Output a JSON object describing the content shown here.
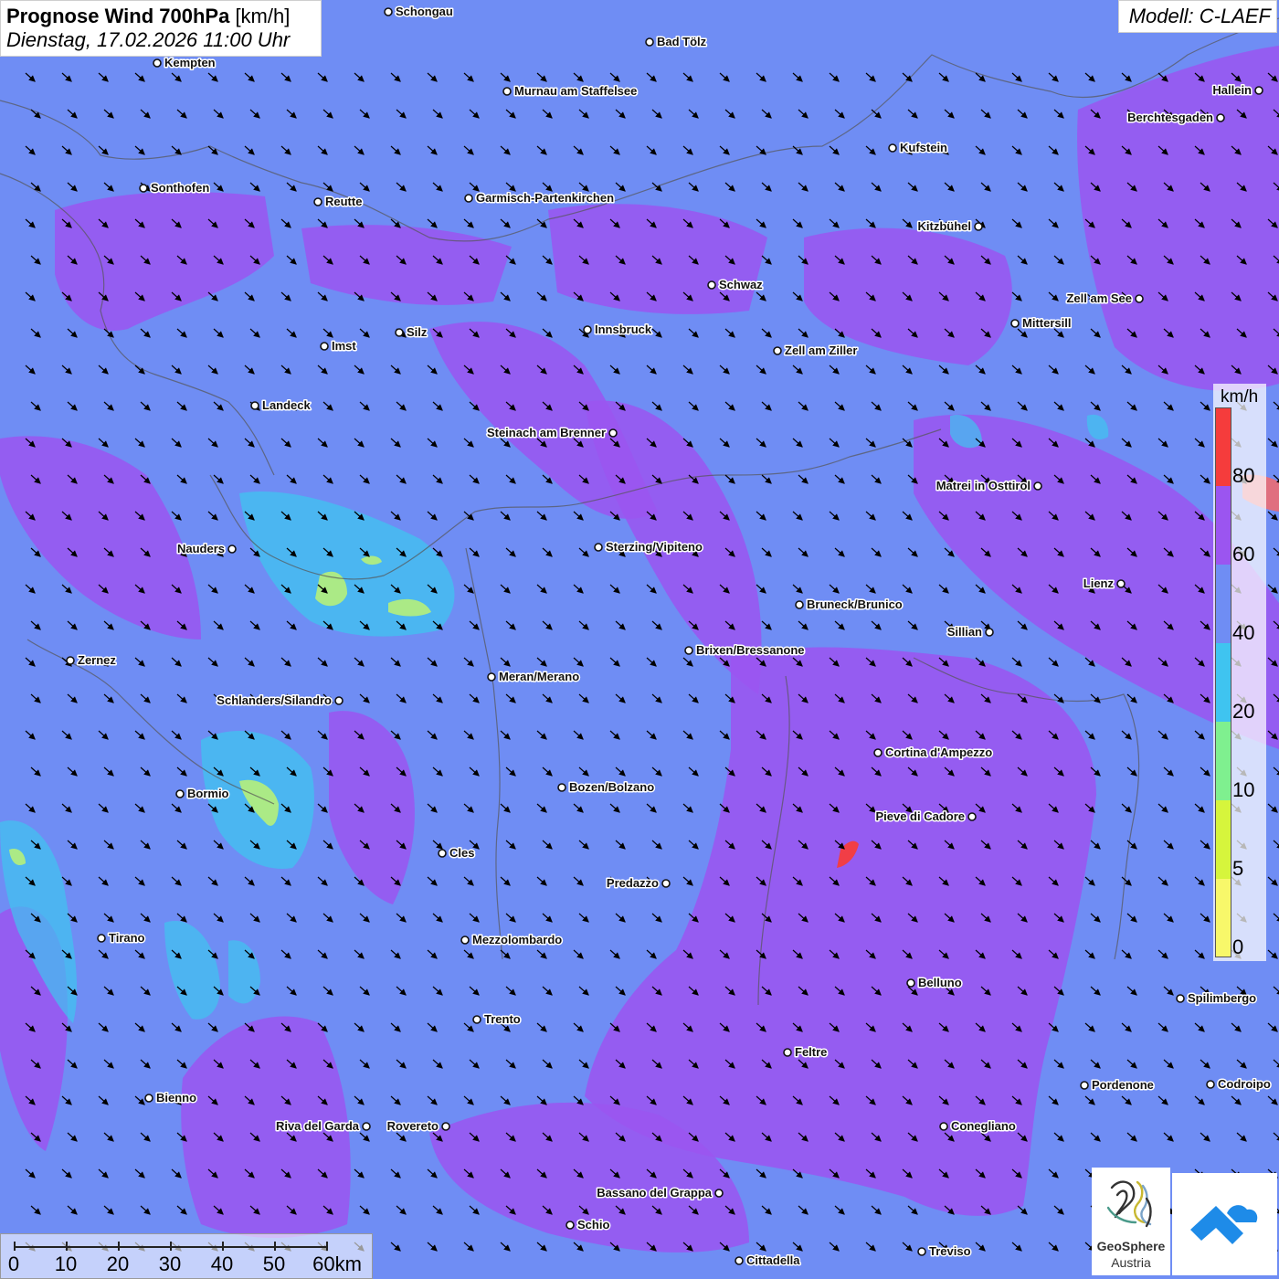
{
  "header": {
    "title_main": "Prognose Wind 700hPa",
    "title_unit": "[km/h]",
    "datetime": "Dienstag, 17.02.2026 11:00 Uhr"
  },
  "model": {
    "label": "Modell: C-LAEF"
  },
  "legend": {
    "unit": "km/h",
    "ticks": [
      "80",
      "60",
      "40",
      "20",
      "10",
      "5",
      "0"
    ],
    "colors": [
      "#f53c3c",
      "#9b55f0",
      "#6f8df4",
      "#3fc4f0",
      "#7ff08f",
      "#d6f53c",
      "#f8f86a"
    ]
  },
  "colors": {
    "background": "#6f8df4",
    "band_20_40": "#56b3f0",
    "band_40_60": "#6f8df4",
    "band_60_80": "#9b55f0",
    "band_80_plus": "#f53c3c",
    "band_5_10": "#b6f07a",
    "arrow": "#000000"
  },
  "wind": {
    "direction": "north-west wind, arrows pointing south-east"
  },
  "cities": [
    {
      "name": "Schongau"
    },
    {
      "name": "Bad Tölz"
    },
    {
      "name": "Kempten"
    },
    {
      "name": "Murnau am Staffelsee"
    },
    {
      "name": "Hallein"
    },
    {
      "name": "Berchtesgaden"
    },
    {
      "name": "Kufstein"
    },
    {
      "name": "Sonthofen"
    },
    {
      "name": "Reutte"
    },
    {
      "name": "Garmisch-Partenkirchen"
    },
    {
      "name": "Kitzbühel"
    },
    {
      "name": "Schwaz"
    },
    {
      "name": "Zell am See"
    },
    {
      "name": "Innsbruck"
    },
    {
      "name": "Silz"
    },
    {
      "name": "Imst"
    },
    {
      "name": "Mittersill"
    },
    {
      "name": "Zell am Ziller"
    },
    {
      "name": "Landeck"
    },
    {
      "name": "Steinach am Brenner"
    },
    {
      "name": "Matrei in Osttirol"
    },
    {
      "name": "Nauders"
    },
    {
      "name": "Sterzing/Vipiteno"
    },
    {
      "name": "Lienz"
    },
    {
      "name": "Bruneck/Brunico"
    },
    {
      "name": "Sillian"
    },
    {
      "name": "Brixen/Bressanone"
    },
    {
      "name": "Zernez"
    },
    {
      "name": "Meran/Merano"
    },
    {
      "name": "Schlanders/Silandro"
    },
    {
      "name": "Cortina d'Ampezzo"
    },
    {
      "name": "Bozen/Bolzano"
    },
    {
      "name": "Bormio"
    },
    {
      "name": "Pieve di Cadore"
    },
    {
      "name": "Cles"
    },
    {
      "name": "Predazzo"
    },
    {
      "name": "Tirano"
    },
    {
      "name": "Mezzolombardo"
    },
    {
      "name": "Belluno"
    },
    {
      "name": "Spilimbergo"
    },
    {
      "name": "Trento"
    },
    {
      "name": "Feltre"
    },
    {
      "name": "Bienno"
    },
    {
      "name": "Pordenone"
    },
    {
      "name": "Codroipo"
    },
    {
      "name": "Riva del Garda"
    },
    {
      "name": "Rovereto"
    },
    {
      "name": "Conegliano"
    },
    {
      "name": "Bassano del Grappa"
    },
    {
      "name": "Schio"
    },
    {
      "name": "Treviso"
    },
    {
      "name": "Cittadella"
    }
  ],
  "scale": {
    "ticks": [
      "0",
      "10",
      "20",
      "30",
      "40",
      "50",
      "60km"
    ]
  },
  "logos": {
    "geosphere_name": "GeoSphere",
    "geosphere_sub": "Austria",
    "geosphere_icon": "geosphere-logo",
    "app_icon": "cloud-arrow-logo"
  }
}
